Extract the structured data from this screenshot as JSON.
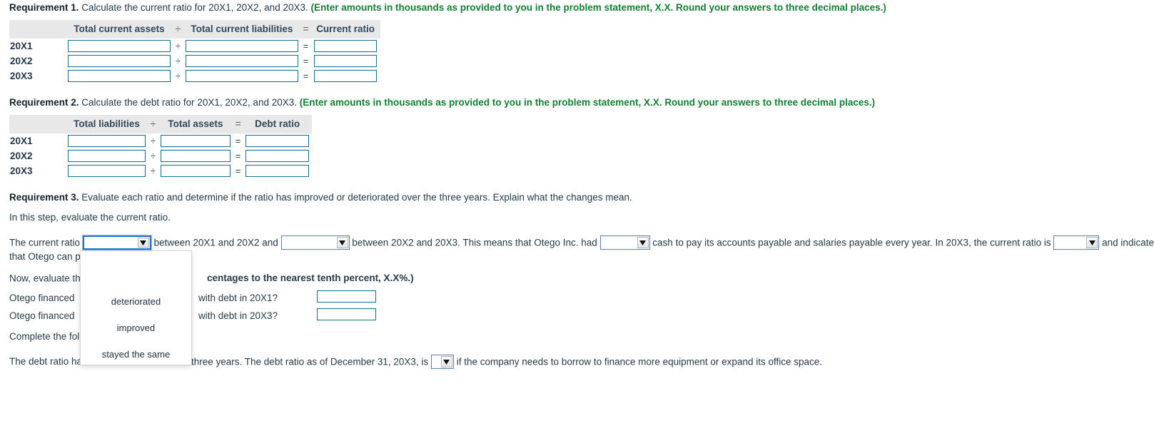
{
  "requirement1": {
    "label": "Requirement 1.",
    "text": " Calculate the current ratio for 20X1, 20X2, and 20X3. ",
    "note": "(Enter amounts in thousands as provided to you in the problem statement, X.X. Round your answers to three decimal places.)",
    "table": {
      "headers": [
        "",
        "Total current assets",
        "÷",
        "Total current liabilities",
        "=",
        "Current ratio"
      ],
      "rows": [
        {
          "label": "20X1",
          "op1": "÷",
          "op2": "=",
          "v1": "",
          "v2": "",
          "v3": ""
        },
        {
          "label": "20X2",
          "op1": "÷",
          "op2": "=",
          "v1": "",
          "v2": "",
          "v3": ""
        },
        {
          "label": "20X3",
          "op1": "÷",
          "op2": "=",
          "v1": "",
          "v2": "",
          "v3": ""
        }
      ]
    }
  },
  "requirement2": {
    "label": "Requirement 2.",
    "text": " Calculate the debt ratio for 20X1, 20X2, and 20X3. ",
    "note": "(Enter amounts in thousands as provided to you in the problem statement, X.X. Round your answers to three decimal places.)",
    "table": {
      "headers": [
        "",
        "Total liabilities",
        "÷",
        "Total assets",
        "=",
        "Debt ratio"
      ],
      "rows": [
        {
          "label": "20X1",
          "op1": "÷",
          "op2": "=",
          "v1": "",
          "v2": "",
          "v3": ""
        },
        {
          "label": "20X2",
          "op1": "÷",
          "op2": "=",
          "v1": "",
          "v2": "",
          "v3": ""
        },
        {
          "label": "20X3",
          "op1": "÷",
          "op2": "=",
          "v1": "",
          "v2": "",
          "v3": ""
        }
      ]
    }
  },
  "requirement3": {
    "label": "Requirement 3.",
    "text": " Evaluate each ratio and determine if the ratio has improved or deteriorated over the three years. Explain what the changes mean.",
    "step_intro": "In this step, evaluate the current ratio.",
    "sentence1": {
      "part1": "The current ratio",
      "select1_value": "",
      "part2": "between 20X1 and 20X2 and",
      "select2_value": "",
      "part3": "between 20X2 and 20X3. This means that Otego Inc. had",
      "select3_value": "",
      "part4": "cash to pay its accounts payable and salaries payable every year. In 20X3, the current ratio is",
      "select4_value": "",
      "part5": "and indicates"
    },
    "sentence2_cont": "that Otego can pa",
    "debt_intro": {
      "prefix": "Now, evaluate the",
      "note": "centages to the nearest tenth percent, X.X%.)"
    },
    "questions": [
      {
        "prefix": "Otego financed ",
        "suffix": "with debt in 20X1?",
        "value": ""
      },
      {
        "prefix": "Otego financed ",
        "suffix": "with debt in 20X3?",
        "value": ""
      }
    ],
    "complete_line": "Complete the follo",
    "final_sentence": {
      "part1": "The debt ratio has",
      "part2": "three years. The debt ratio as of December 31, 20X3, is",
      "select_value": "",
      "part3": "if the company needs to borrow to finance more equipment or expand its office space."
    }
  },
  "dropdown": {
    "options": [
      "",
      "deteriorated",
      "improved",
      "stayed the same"
    ],
    "visible_options": [
      "deteriorated",
      "improved",
      "stayed the same"
    ]
  },
  "icons": {
    "chevron_down": "chevron-down-icon"
  },
  "colors": {
    "input_border": "#0a7191",
    "note_green": "#128033",
    "header_bg": "#e8e8e8",
    "text": "#243b4a",
    "focus_blue": "#2a6fd6"
  }
}
